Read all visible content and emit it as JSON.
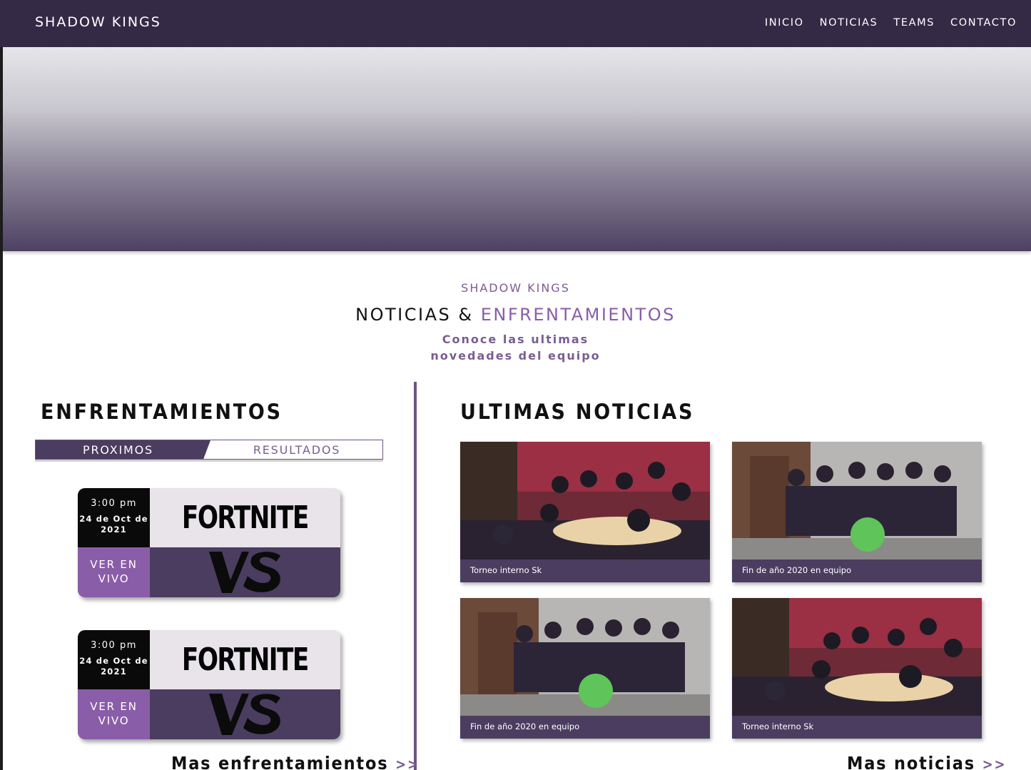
{
  "nav": {
    "brand": "SHADOW KINGS",
    "items": [
      "INICIO",
      "NOTICIAS",
      "TEAMS",
      "CONTACTO"
    ]
  },
  "section": {
    "kicker": "SHADOW KINGS",
    "headline_main": "NOTICIAS &",
    "headline_accent": "ENFRENTAMIENTOS",
    "sub_line1": "Conoce las ultimas",
    "sub_line2": "novedades del equipo"
  },
  "matches": {
    "title": "ENFRENTAMIENTOS",
    "tab_active": "PROXIMOS",
    "tab_inactive": "RESULTADOS",
    "items": [
      {
        "time": "3:00 pm",
        "date": "24 de Oct de 2021",
        "game": "FORTNITE",
        "live_label": "VER EN VIVO"
      },
      {
        "time": "3:00 pm",
        "date": "24 de Oct de 2021",
        "game": "FORTNITE",
        "live_label": "VER EN VIVO"
      }
    ],
    "more_label": "Mas enfrentamientos",
    "more_arrows": ">>"
  },
  "news": {
    "title": "ULTIMAS NOTICIAS",
    "items": [
      {
        "caption": "Torneo interno Sk"
      },
      {
        "caption": "Fin de año 2020 en equipo"
      },
      {
        "caption": "Fin de año 2020 en equipo"
      },
      {
        "caption": "Torneo interno Sk"
      }
    ],
    "more_label": "Mas noticias",
    "more_arrows": ">>"
  },
  "colors": {
    "nav_bg": "#352a45",
    "accent": "#8a5da8",
    "panel_dark": "#4a3d60"
  }
}
